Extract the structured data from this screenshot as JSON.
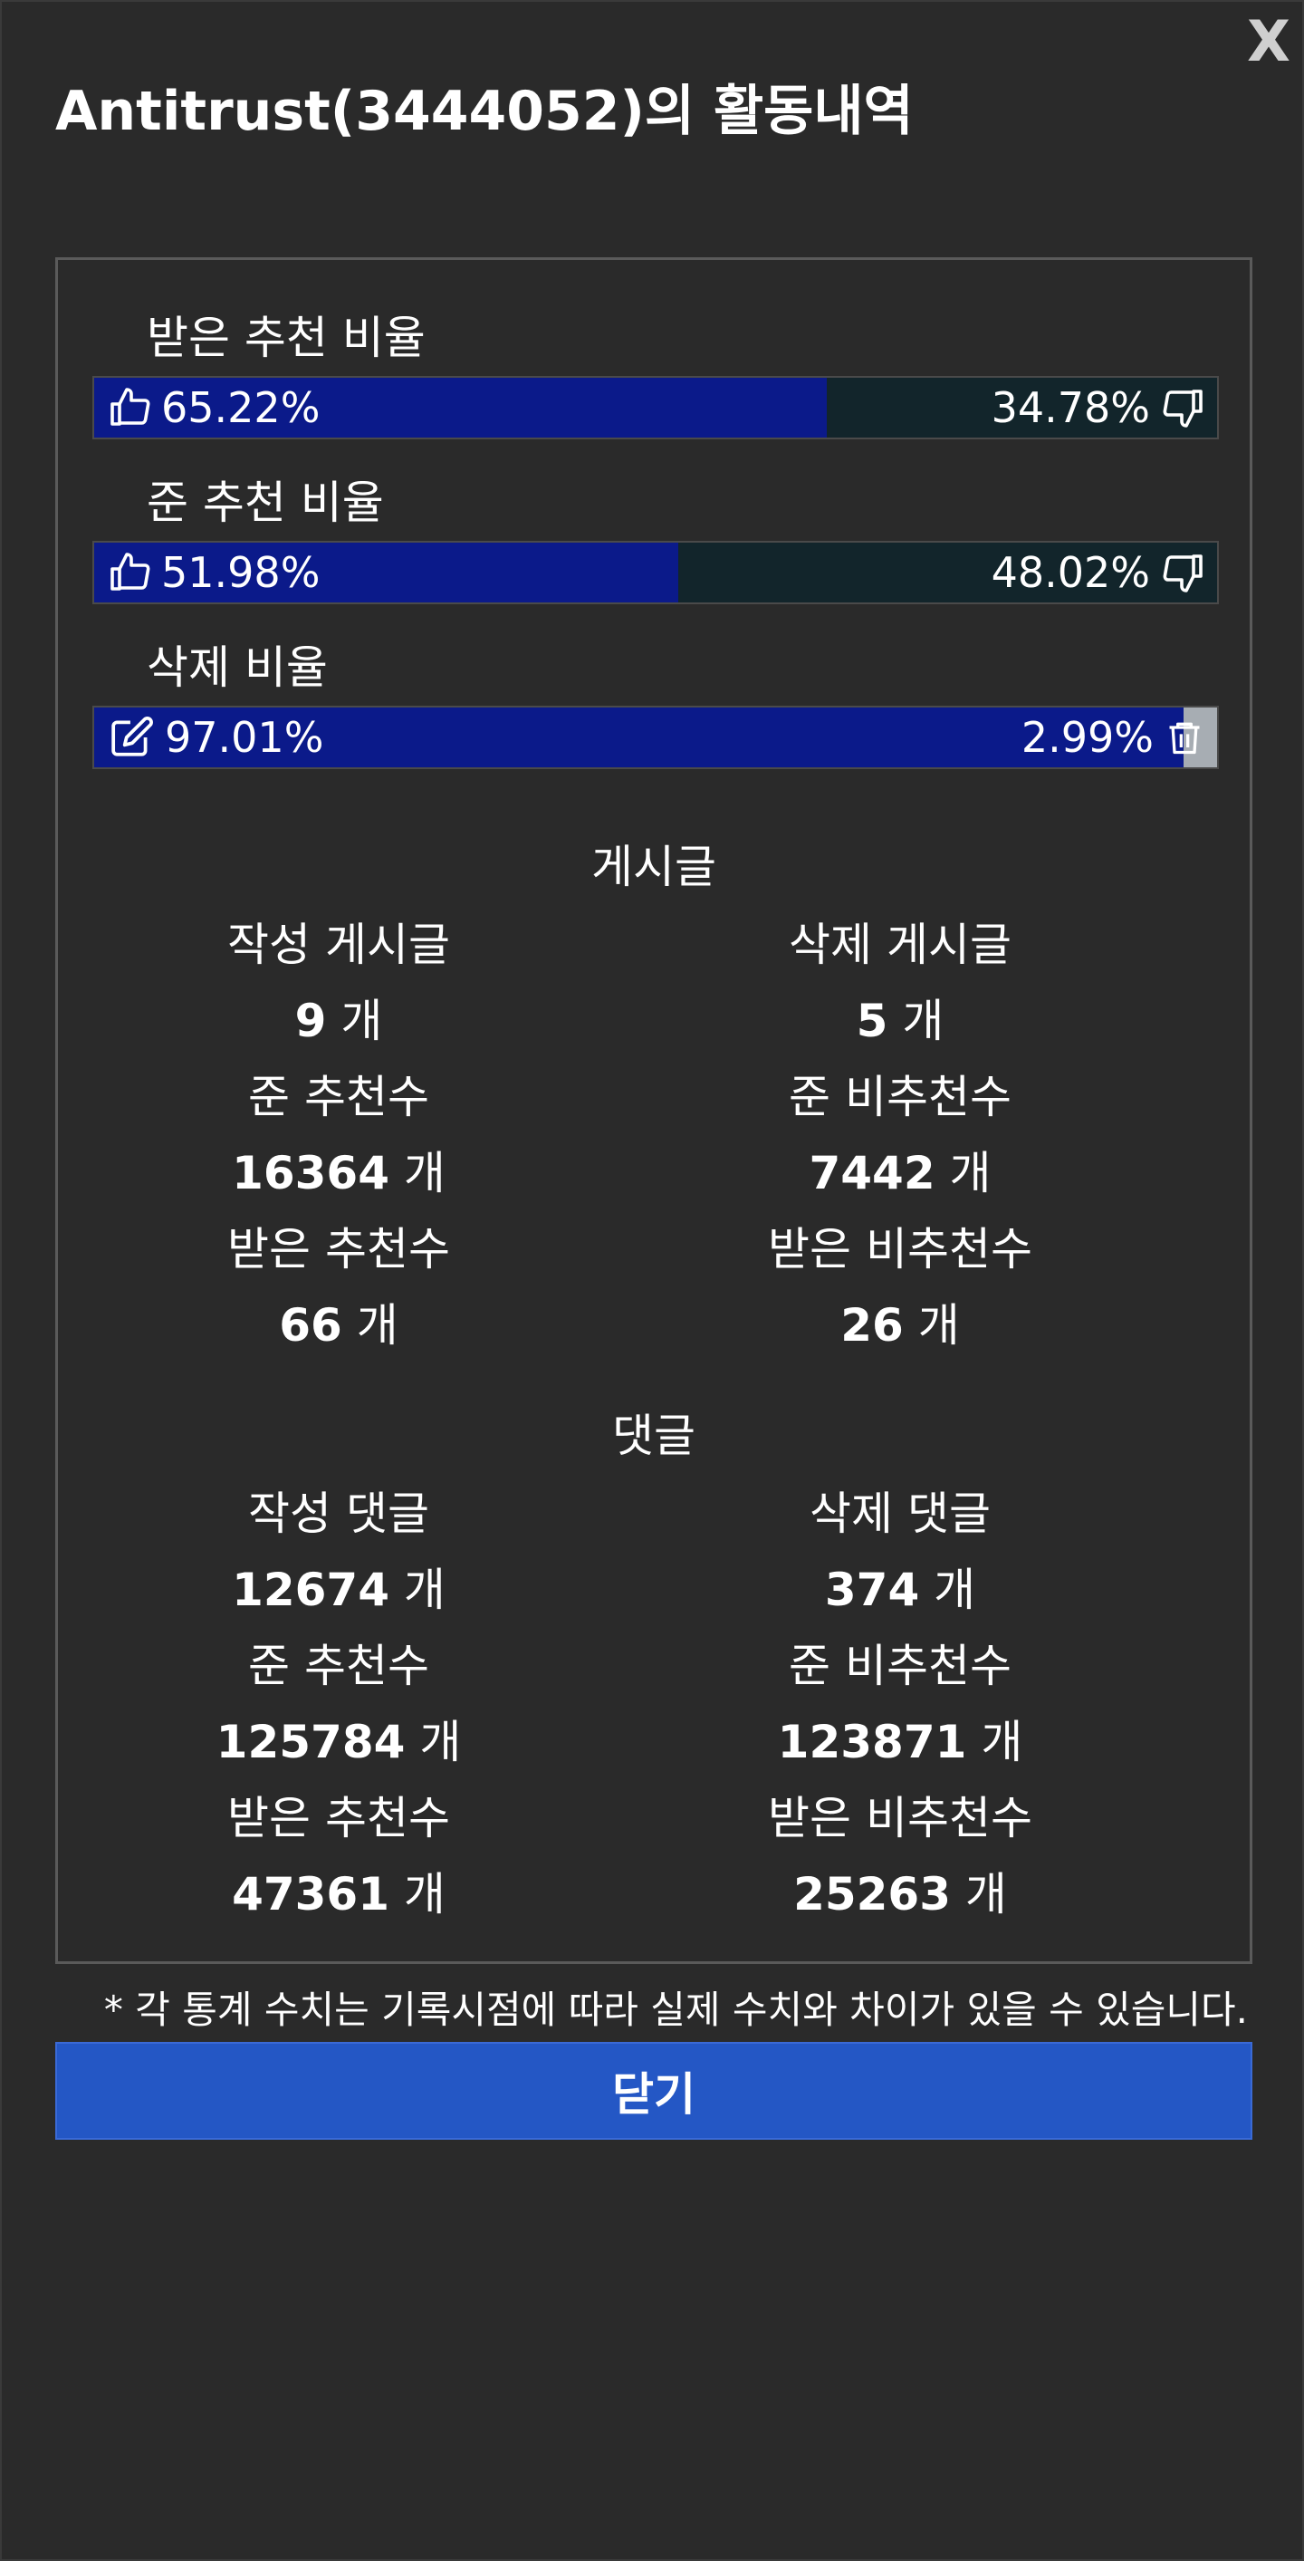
{
  "modal": {
    "close_glyph": "X",
    "title": "Antitrust(3444052)의 활동내역"
  },
  "ratios": [
    {
      "label": "받은 추천 비율",
      "left_value": "65.22%",
      "right_value": "34.78%",
      "left_fraction": 0.6522,
      "left_icon": "thumbs-up-icon",
      "right_icon": "thumbs-down-icon"
    },
    {
      "label": "준 추천 비율",
      "left_value": "51.98%",
      "right_value": "48.02%",
      "left_fraction": 0.5198,
      "left_icon": "thumbs-up-icon",
      "right_icon": "thumbs-down-icon"
    },
    {
      "label": "삭제 비율",
      "left_value": "97.01%",
      "right_value": "2.99%",
      "left_fraction": 0.9701,
      "left_icon": "edit-icon",
      "right_icon": "trash-icon"
    }
  ],
  "posts": {
    "title": "게시글",
    "written_label": "작성 게시글",
    "written_value": "9",
    "deleted_label": "삭제 게시글",
    "deleted_value": "5",
    "given_up_label": "준 추천수",
    "given_up_value": "16364",
    "given_down_label": "준 비추천수",
    "given_down_value": "7442",
    "received_up_label": "받은 추천수",
    "received_up_value": "66",
    "received_down_label": "받은 비추천수",
    "received_down_value": "26"
  },
  "comments": {
    "title": "댓글",
    "written_label": "작성 댓글",
    "written_value": "12674",
    "deleted_label": "삭제 댓글",
    "deleted_value": "374",
    "given_up_label": "준 추천수",
    "given_up_value": "125784",
    "given_down_label": "준 비추천수",
    "given_down_value": "123871",
    "received_up_label": "받은 추천수",
    "received_up_value": "47361",
    "received_down_label": "받은 비추천수",
    "received_down_value": "25263"
  },
  "unit": "개",
  "footnote": "* 각 통계 수치는 기록시점에 따라 실제 수치와 차이가 있을 수 있습니다.",
  "close_button_label": "닫기",
  "colors": {
    "bar_fill": "#0b1a8a",
    "bar_rest": "#12252b",
    "button": "#2457c5",
    "background": "#2a2a2a"
  }
}
